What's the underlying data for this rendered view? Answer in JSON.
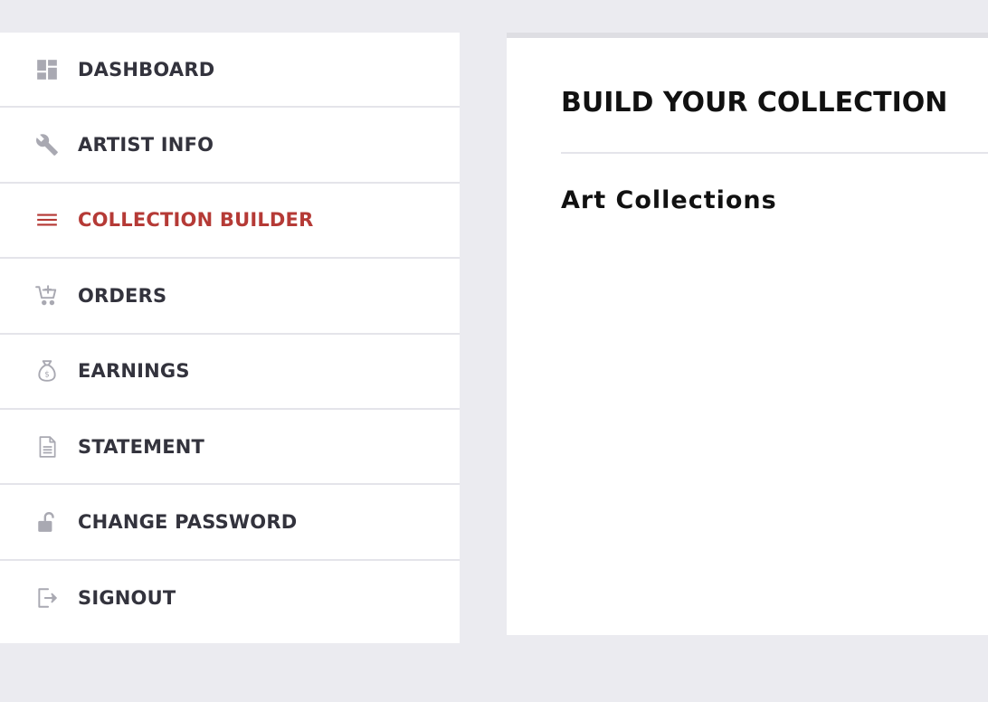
{
  "sidebar": {
    "items": [
      {
        "label": "DASHBOARD",
        "icon": "dashboard-icon",
        "active": false
      },
      {
        "label": "ARTIST INFO",
        "icon": "wrench-icon",
        "active": false
      },
      {
        "label": "COLLECTION BUILDER",
        "icon": "menu-lines-icon",
        "active": true
      },
      {
        "label": "ORDERS",
        "icon": "cart-icon",
        "active": false
      },
      {
        "label": "EARNINGS",
        "icon": "money-bag-icon",
        "active": false
      },
      {
        "label": "STATEMENT",
        "icon": "document-icon",
        "active": false
      },
      {
        "label": "CHANGE PASSWORD",
        "icon": "unlock-icon",
        "active": false
      },
      {
        "label": "SIGNOUT",
        "icon": "signout-icon",
        "active": false
      }
    ]
  },
  "main": {
    "title": "BUILD YOUR COLLECTION",
    "subtitle": "Art Collections"
  },
  "colors": {
    "page_background": "#ebebf0",
    "active_text": "#b53a36",
    "nav_text": "#33333d",
    "icon_gray": "#a9a9b2"
  }
}
